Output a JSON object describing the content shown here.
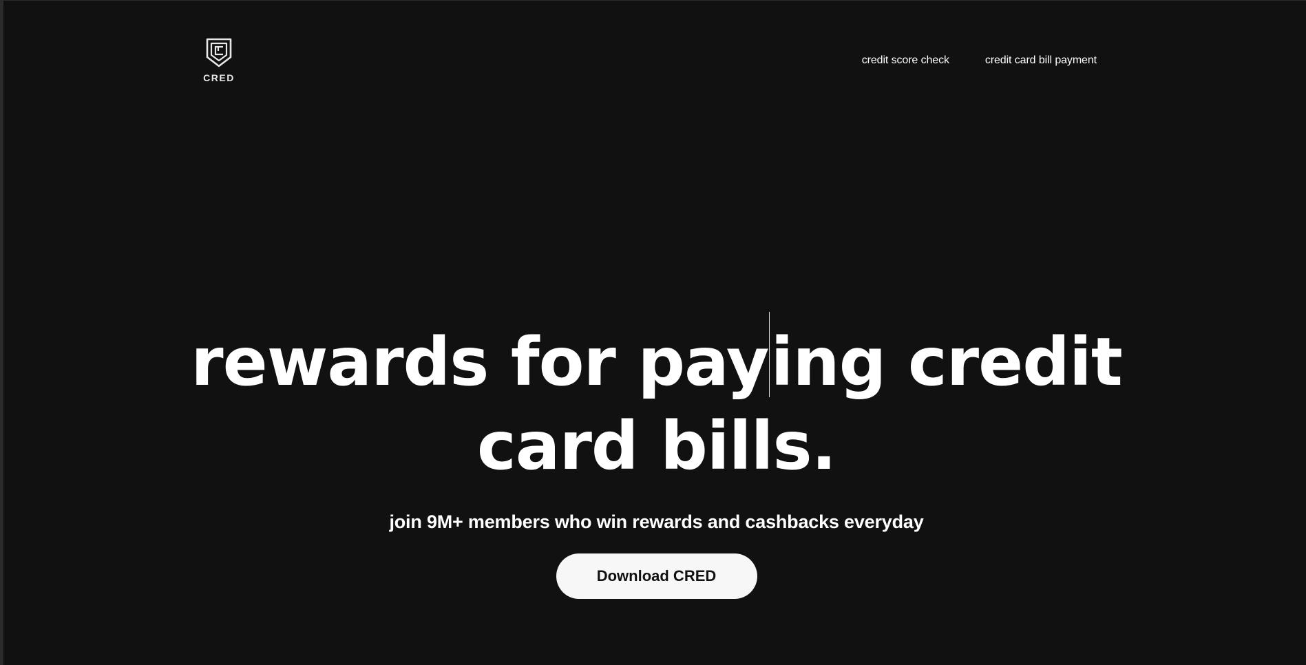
{
  "header": {
    "logo_text": "CRED",
    "logo_icon": "shield-c-icon",
    "nav": [
      {
        "label": "credit score check"
      },
      {
        "label": "credit card bill payment"
      }
    ]
  },
  "hero": {
    "headline_line1_a": "rewards for pay",
    "headline_line1_b": "ing credit",
    "headline_line2": "card bills.",
    "subline": "join 9M+ members who win rewards and cashbacks everyday",
    "cta_label": "Download CRED"
  },
  "colors": {
    "background": "#111111",
    "text": "#ffffff",
    "button_bg": "#f7f7f7",
    "button_text": "#111111"
  }
}
